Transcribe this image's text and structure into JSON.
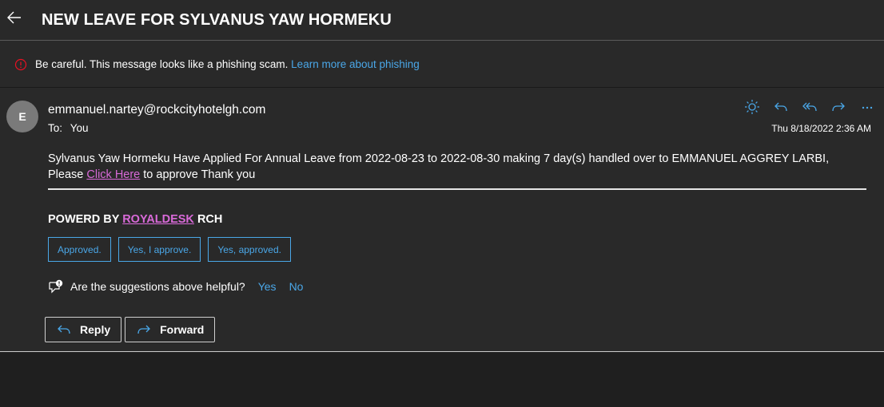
{
  "header": {
    "title": "NEW LEAVE FOR SYLVANUS YAW HORMEKU"
  },
  "warning": {
    "text": "Be careful. This message looks like a phishing scam.",
    "link": "Learn more about phishing"
  },
  "message": {
    "avatar_letter": "E",
    "sender": "emmanuel.nartey@rockcityhotelgh.com",
    "to_label": "To:",
    "to_value": "You",
    "date": "Thu 8/18/2022 2:36 AM",
    "body_line1": "Sylvanus Yaw Hormeku Have Applied For Annual Leave from 2022-08-23 to 2022-08-30 making 7 day(s) handled over to EMMANUEL AGGREY LARBI,",
    "body_line2_prefix": "Please",
    "body_link": "Click Here",
    "body_line2_suffix": "to approve Thank you",
    "powered_prefix": "POWERD BY",
    "powered_link": "ROYALDESK",
    "powered_suffix": "RCH"
  },
  "suggested_replies": [
    "Approved.",
    "Yes, I approve.",
    "Yes, approved."
  ],
  "feedback": {
    "question": "Are the suggestions above helpful?",
    "yes": "Yes",
    "no": "No"
  },
  "buttons": {
    "reply": "Reply",
    "forward": "Forward"
  },
  "icons": {
    "back": "arrow-left-icon",
    "warning": "alert-circle-icon",
    "actions": [
      "sun-icon",
      "reply-icon",
      "reply-all-icon",
      "forward-icon",
      "more-icon"
    ]
  },
  "colors": {
    "background": "#292929",
    "accent": "#4aa7e8",
    "link": "#d96ad9",
    "warning": "#e81123"
  }
}
